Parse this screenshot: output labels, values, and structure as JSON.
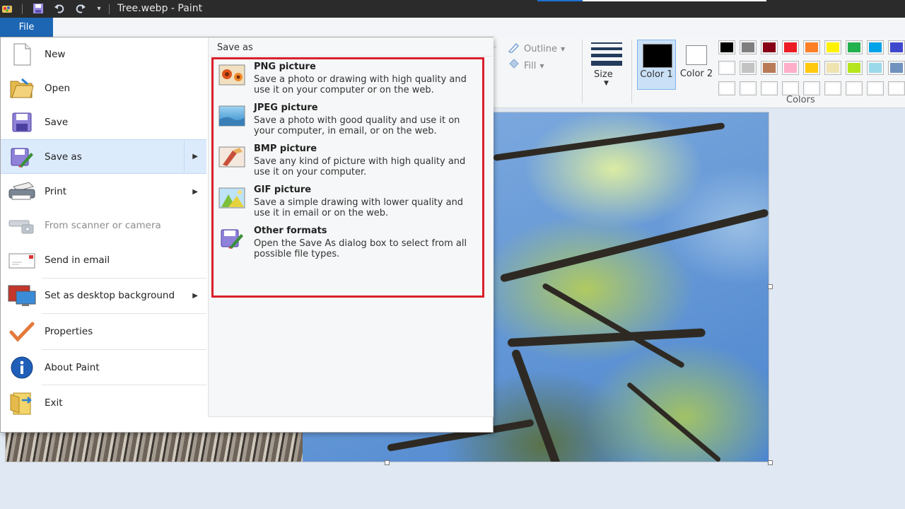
{
  "window": {
    "title": "Tree.webp - Paint"
  },
  "quick_access": {
    "icons": [
      "paint-app-icon",
      "save-icon",
      "undo-icon",
      "redo-icon",
      "customize-dropdown-icon"
    ]
  },
  "ribbon": {
    "file_tab": "File",
    "outline_label": "Outline",
    "fill_label": "Fill",
    "size_label": "Size",
    "color1_label": "Color 1",
    "color2_label": "Color 2",
    "colors_group_label": "Colors",
    "color1_value": "#000000",
    "color2_value": "#ffffff",
    "palette_row1": [
      "#000000",
      "#7f7f7f",
      "#880015",
      "#ed1c24",
      "#ff7f27",
      "#fff200",
      "#22b14c",
      "#00a2e8",
      "#3f48cc"
    ],
    "palette_row2": [
      "#ffffff",
      "#c3c3c3",
      "#b97a57",
      "#ffaec9",
      "#ffc90e",
      "#efe4b0",
      "#b5e61d",
      "#99d9ea",
      "#7092be"
    ],
    "palette_row3": [
      "#ffffff",
      "#ffffff",
      "#ffffff",
      "#ffffff",
      "#ffffff",
      "#ffffff",
      "#ffffff",
      "#ffffff",
      "#ffffff"
    ]
  },
  "file_menu": {
    "items": [
      {
        "label": "New",
        "icon": "new-document-icon"
      },
      {
        "label": "Open",
        "icon": "open-folder-icon"
      },
      {
        "label": "Save",
        "icon": "save-disk-icon"
      },
      {
        "label": "Save as",
        "icon": "save-as-icon",
        "submenu": true,
        "selected": true
      },
      {
        "label": "Print",
        "icon": "printer-icon",
        "submenu": true
      },
      {
        "label": "From scanner or camera",
        "icon": "scanner-icon",
        "disabled": true
      },
      {
        "label": "Send in email",
        "icon": "email-icon"
      },
      {
        "label": "Set as desktop background",
        "icon": "desktop-icon",
        "submenu": true
      },
      {
        "label": "Properties",
        "icon": "checkmark-icon"
      },
      {
        "label": "About Paint",
        "icon": "info-icon"
      },
      {
        "label": "Exit",
        "icon": "exit-icon"
      }
    ]
  },
  "save_as": {
    "title": "Save as",
    "options": [
      {
        "title": "PNG picture",
        "desc": "Save a photo or drawing with high quality and use it on your computer or on the web.",
        "icon": "png-picture-icon"
      },
      {
        "title": "JPEG picture",
        "desc": "Save a photo with good quality and use it on your computer, in email, or on the web.",
        "icon": "jpeg-picture-icon"
      },
      {
        "title": "BMP picture",
        "desc": "Save any kind of picture with high quality and use it on your computer.",
        "icon": "bmp-picture-icon"
      },
      {
        "title": "GIF picture",
        "desc": "Save a simple drawing with lower quality and use it in email or on the web.",
        "icon": "gif-picture-icon"
      },
      {
        "title": "Other formats",
        "desc": "Open the Save As dialog box to select from all possible file types.",
        "icon": "other-formats-icon"
      }
    ],
    "highlight_color": "#d9202c"
  }
}
